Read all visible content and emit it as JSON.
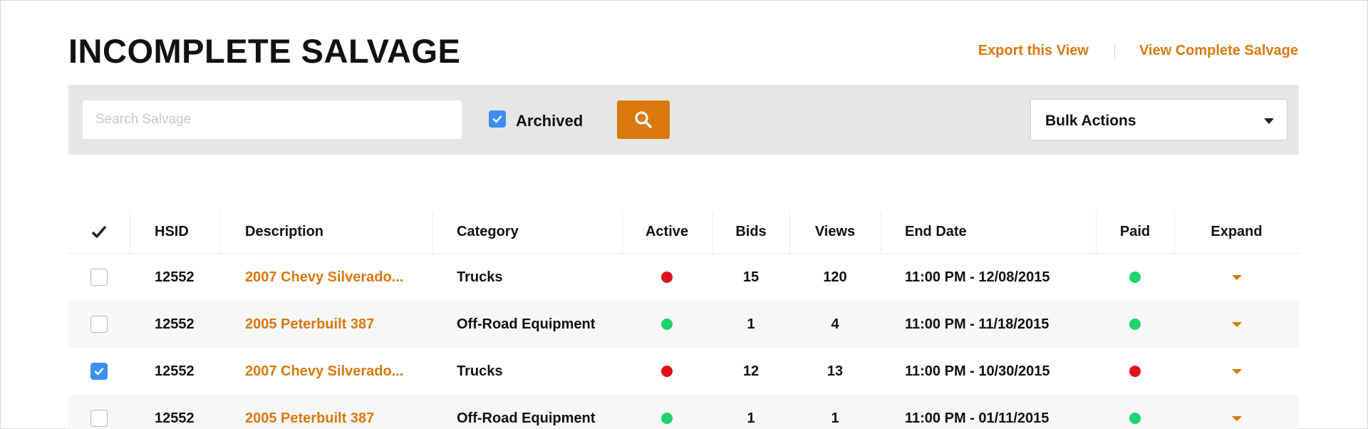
{
  "header": {
    "title": "INCOMPLETE SALVAGE",
    "export_link": "Export this View",
    "complete_link": "View Complete Salvage"
  },
  "toolbar": {
    "search_placeholder": "Search Salvage",
    "search_value": "",
    "archived_label": "Archived",
    "archived_checked": true,
    "bulk_actions_label": "Bulk Actions"
  },
  "table": {
    "columns": [
      "HSID",
      "Description",
      "Category",
      "Active",
      "Bids",
      "Views",
      "End Date",
      "Paid",
      "Expand"
    ],
    "rows": [
      {
        "checked": false,
        "hsid": "12552",
        "description": "2007 Chevy Silverado...",
        "category": "Trucks",
        "active": "red",
        "bids": "15",
        "views": "120",
        "end_date": "11:00 PM - 12/08/2015",
        "paid": "green"
      },
      {
        "checked": false,
        "hsid": "12552",
        "description": "2005 Peterbuilt 387",
        "category": "Off-Road Equipment",
        "active": "green",
        "bids": "1",
        "views": "4",
        "end_date": "11:00 PM - 11/18/2015",
        "paid": "green"
      },
      {
        "checked": true,
        "hsid": "12552",
        "description": "2007 Chevy Silverado...",
        "category": "Trucks",
        "active": "red",
        "bids": "12",
        "views": "13",
        "end_date": "11:00 PM - 10/30/2015",
        "paid": "red"
      },
      {
        "checked": false,
        "hsid": "12552",
        "description": "2005 Peterbuilt 387",
        "category": "Off-Road Equipment",
        "active": "green",
        "bids": "1",
        "views": "1",
        "end_date": "11:00 PM - 01/11/2015",
        "paid": "green"
      }
    ]
  },
  "colors": {
    "accent": "#d9780e",
    "checkbox": "#3d8ef0",
    "status_green": "#1fd46c",
    "status_red": "#e0101a",
    "toolbar_bg": "#e6e6e6",
    "row_alt_bg": "#f7f7f7"
  },
  "icons": {
    "select_all": "checkmark-icon",
    "search": "search-icon",
    "bulk_caret": "chevron-down-icon",
    "expand": "caret-down-icon"
  }
}
